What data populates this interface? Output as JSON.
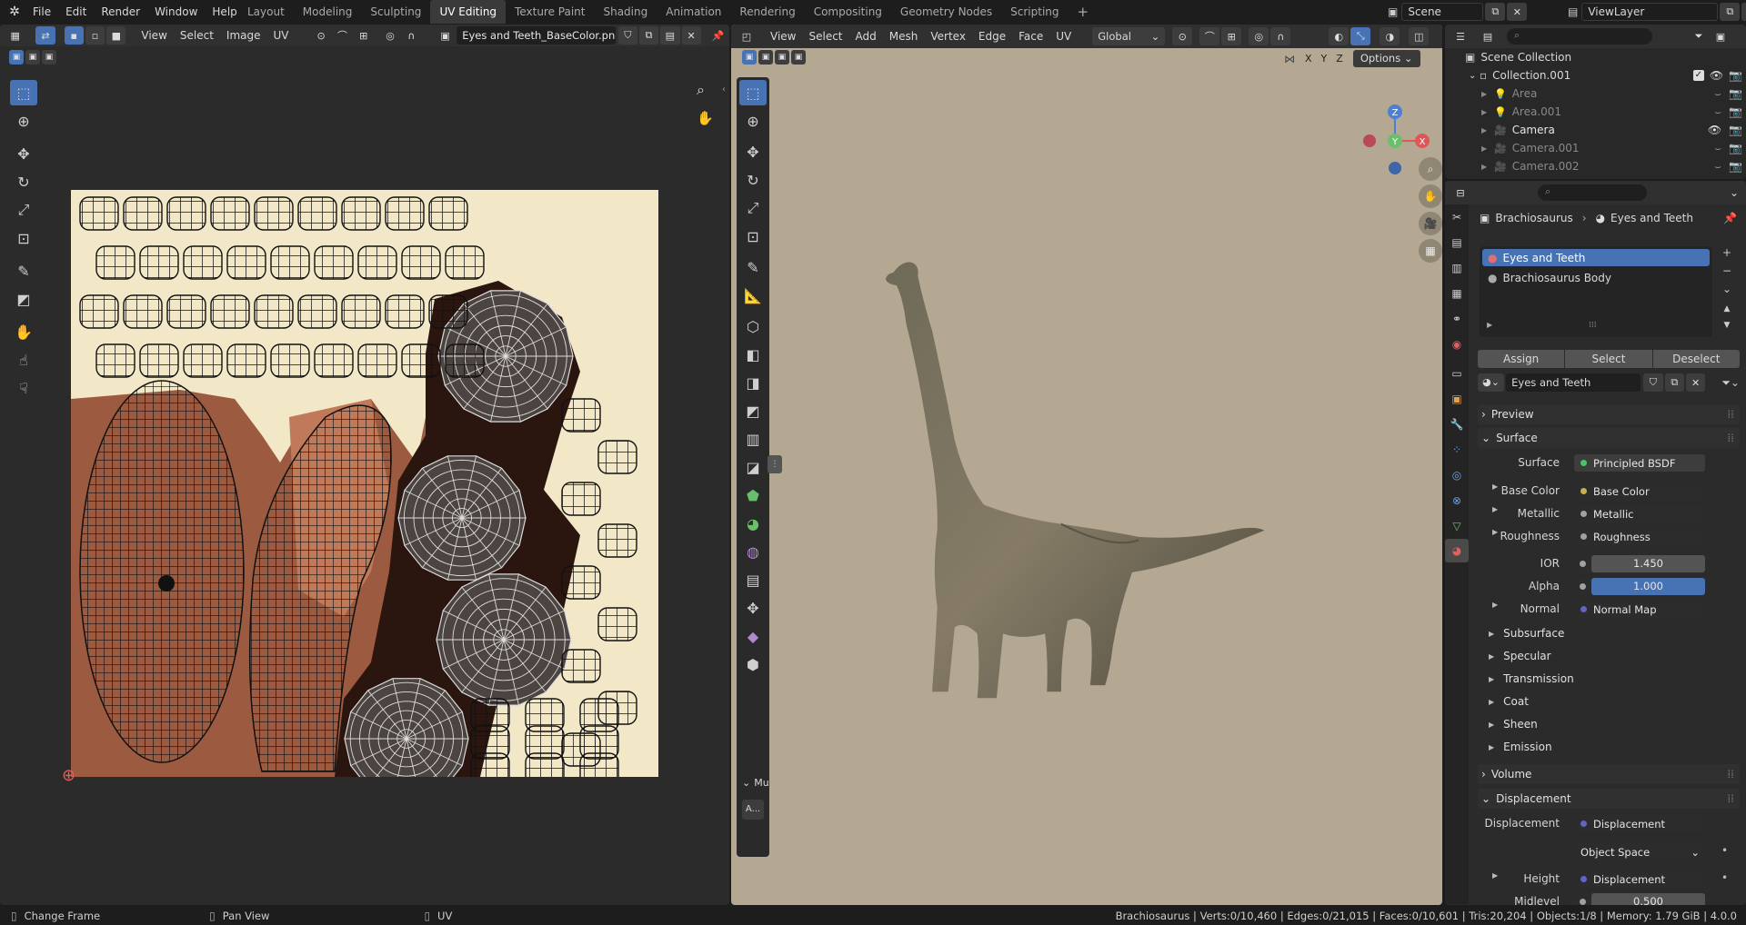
{
  "topbar": {
    "menus": [
      "File",
      "Edit",
      "Render",
      "Window",
      "Help"
    ],
    "workspaces": [
      "Layout",
      "Modeling",
      "Sculpting",
      "UV Editing",
      "Texture Paint",
      "Shading",
      "Animation",
      "Rendering",
      "Compositing",
      "Geometry Nodes",
      "Scripting"
    ],
    "active_workspace": "UV Editing",
    "add_tab": "+",
    "scene": "Scene",
    "view_layer": "ViewLayer"
  },
  "uv_editor": {
    "menus": [
      "View",
      "Select",
      "Image",
      "UV"
    ],
    "image_name": "Eyes and Teeth_BaseColor.png"
  },
  "viewport": {
    "menus": [
      "View",
      "Select",
      "Add",
      "Mesh",
      "Vertex",
      "Edge",
      "Face",
      "UV"
    ],
    "orientation": "Global",
    "axes": [
      "X",
      "Y",
      "Z"
    ],
    "options_label": "Options",
    "gizmo": {
      "x": "X",
      "y": "Y",
      "z": "Z"
    },
    "last_op_collapsed": "Mu",
    "last_op_button": "A..."
  },
  "outliner": {
    "root": "Scene Collection",
    "collection": "Collection.001",
    "items": [
      {
        "name": "Area",
        "dim": true
      },
      {
        "name": "Area.001",
        "dim": true
      },
      {
        "name": "Camera",
        "dim": false
      },
      {
        "name": "Camera.001",
        "dim": true
      },
      {
        "name": "Camera.002",
        "dim": true
      }
    ]
  },
  "properties": {
    "breadcrumb_object": "Brachiosaurus",
    "breadcrumb_material": "Eyes and Teeth",
    "slots": [
      "Eyes and Teeth",
      "Brachiosaurus Body"
    ],
    "buttons": {
      "assign": "Assign",
      "select": "Select",
      "deselect": "Deselect"
    },
    "material_name": "Eyes and Teeth",
    "sections": {
      "preview": "Preview",
      "surface": "Surface",
      "volume": "Volume",
      "displacement": "Displacement"
    },
    "surface_shader_label": "Surface",
    "surface_shader": "Principled BSDF",
    "inputs": [
      {
        "label": "Base Color",
        "value": "Base Color",
        "color": "#c7b14c"
      },
      {
        "label": "Metallic",
        "value": "Metallic",
        "color": "#a1a1a1"
      },
      {
        "label": "Roughness",
        "value": "Roughness",
        "color": "#a1a1a1"
      }
    ],
    "ior_label": "IOR",
    "ior": "1.450",
    "alpha_label": "Alpha",
    "alpha": "1.000",
    "normal_label": "Normal",
    "normal_value": "Normal Map",
    "subpanels": [
      "Subsurface",
      "Specular",
      "Transmission",
      "Coat",
      "Sheen",
      "Emission"
    ],
    "disp_label": "Displacement",
    "disp_value": "Displacement",
    "disp_space": "Object Space",
    "height_label": "Height",
    "height_value": "Displacement",
    "midlevel_label": "Midlevel",
    "midlevel_value": "0.500"
  },
  "statusbar": {
    "left": [
      "Change Frame",
      "Pan View",
      "UV"
    ],
    "stats": "Brachiosaurus | Verts:0/10,460 | Edges:0/21,015 | Faces:0/10,601 | Tris:20,204 | Objects:1/8 | Memory: 1.79 GiB | 4.0.0"
  },
  "colors": {
    "accent": "#4772b3",
    "uv_background": "#f2e8c8",
    "texture_skin": "#9c5a40",
    "texture_dark": "#2a160f",
    "viewport_bg": "#b5a893"
  }
}
